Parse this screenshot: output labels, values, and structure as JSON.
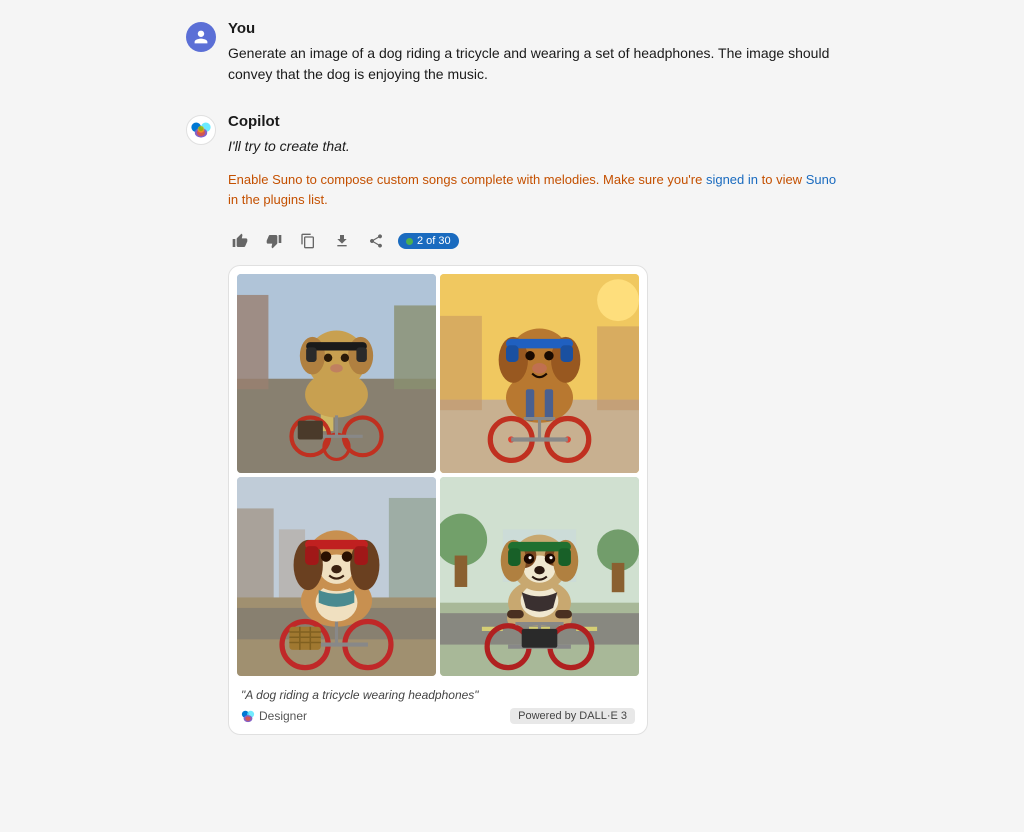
{
  "user": {
    "name": "You",
    "avatar_label": "user-avatar",
    "message": "Generate an image of a dog riding a tricycle and wearing a set of headphones. The image should convey that the dog is enjoying the music."
  },
  "copilot": {
    "name": "Copilot",
    "avatar_label": "copilot-avatar",
    "reply": "I'll try to create that.",
    "suno_notice": "Enable Suno to compose custom songs complete with melodies. Make sure you're signed in to view Suno in the plugins list.",
    "actions": {
      "thumbs_up": "👍",
      "thumbs_down": "👎",
      "copy": "⎘",
      "download": "↓",
      "share": "⤴",
      "count_label": "2 of 30"
    },
    "image_card": {
      "caption": "\"A dog riding a tricycle wearing headphones\"",
      "designer_label": "Designer",
      "dalle_badge": "Powered by DALL·E 3",
      "images": [
        {
          "id": "img1",
          "alt": "Dog on tricycle with headphones - street scene"
        },
        {
          "id": "img2",
          "alt": "Dog on tricycle with blue headphones - outdoor"
        },
        {
          "id": "img3",
          "alt": "Dog on tricycle with headphones - city backdrop"
        },
        {
          "id": "img4",
          "alt": "Dog on tricycle with green headphones - road"
        }
      ]
    }
  },
  "colors": {
    "accent_blue": "#1a6bbf",
    "suno_orange": "#c45000",
    "badge_bg": "#1a6bbf",
    "green_dot": "#4caf50"
  }
}
